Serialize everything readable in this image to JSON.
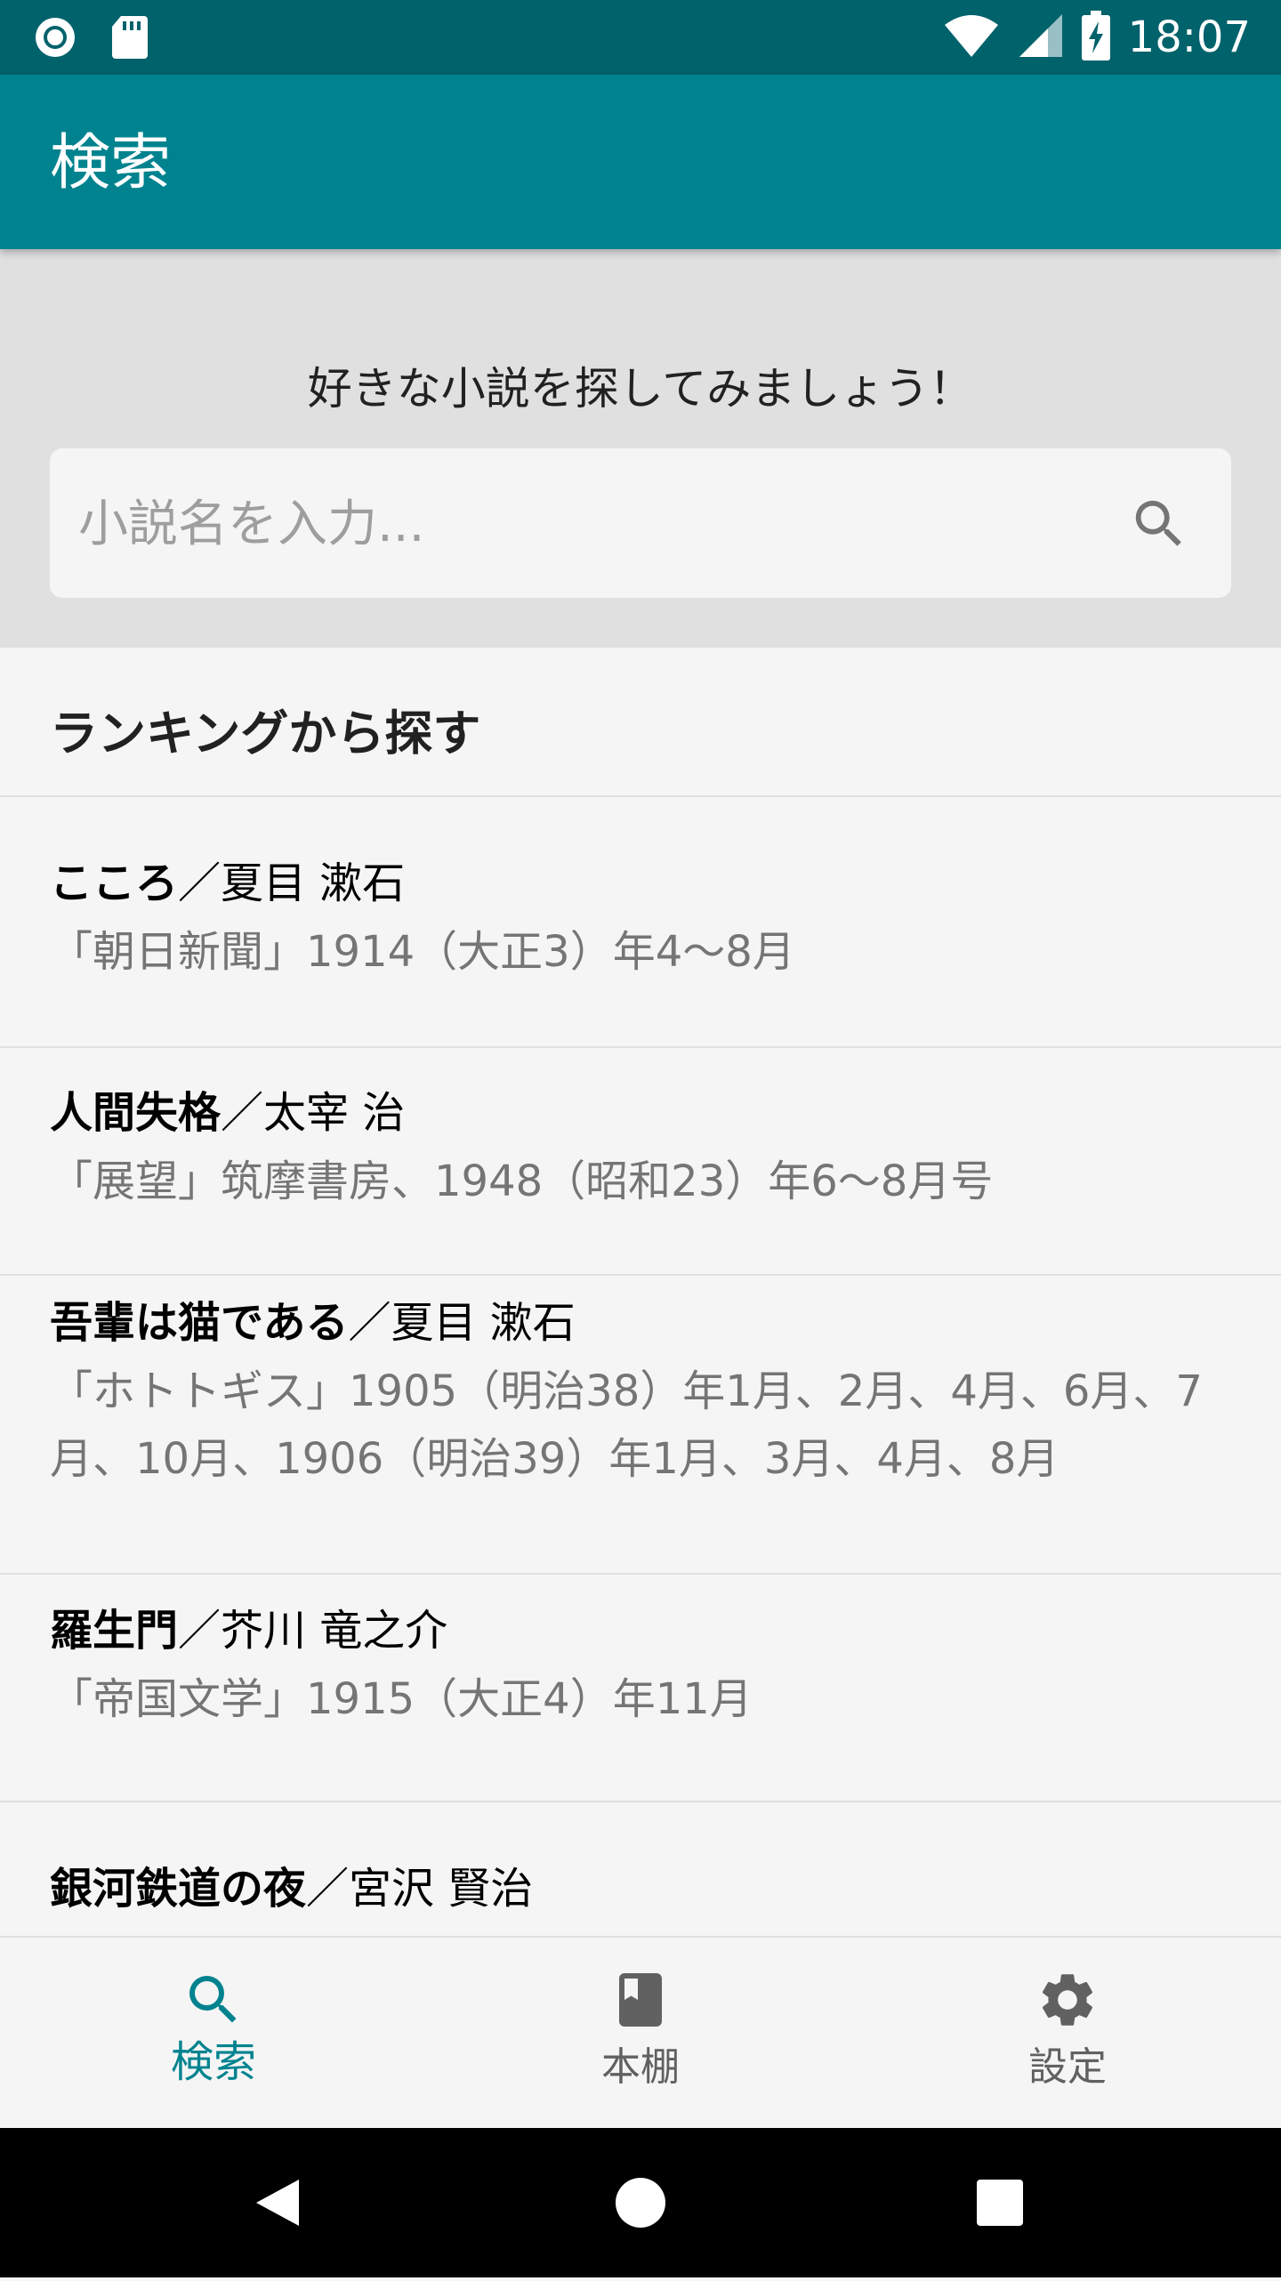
{
  "status_bar": {
    "time": "18:07",
    "icons": [
      "radio-icon",
      "sd-card-icon",
      "wifi-icon",
      "signal-icon",
      "battery-charging-icon"
    ]
  },
  "app_bar": {
    "title": "検索"
  },
  "search": {
    "prompt": "好きな小説を探してみましょう！",
    "placeholder": "小説名を入力...",
    "value": "",
    "button_icon": "search-icon"
  },
  "ranking": {
    "header": "ランキングから探す",
    "items": [
      {
        "title": "こころ",
        "separator": "／",
        "author": "夏目 漱石",
        "publication": "「朝日新聞」1914（大正3）年4〜8月"
      },
      {
        "title": "人間失格",
        "separator": "／",
        "author": "太宰 治",
        "publication": "「展望」筑摩書房、1948（昭和23）年6〜8月号"
      },
      {
        "title": "吾輩は猫である",
        "separator": "／",
        "author": "夏目 漱石",
        "publication": "「ホトトギス」1905（明治38）年1月、2月、4月、6月、7月、10月、1906（明治39）年1月、3月、4月、8月"
      },
      {
        "title": "羅生門",
        "separator": "／",
        "author": "芥川 竜之介",
        "publication": "「帝国文学」1915（大正4）年11月"
      },
      {
        "title": "銀河鉄道の夜",
        "separator": "／",
        "author": "宮沢 賢治",
        "publication": ""
      }
    ]
  },
  "bottom_nav": {
    "items": [
      {
        "label": "検索",
        "icon": "search-icon",
        "active": true
      },
      {
        "label": "本棚",
        "icon": "book-icon",
        "active": false
      },
      {
        "label": "設定",
        "icon": "gear-icon",
        "active": false
      }
    ]
  },
  "colors": {
    "status_bar": "#00626b",
    "app_bar": "#00838f",
    "accent": "#00838f",
    "search_section_bg": "#e0e0e0",
    "page_bg": "#f5f5f5"
  }
}
